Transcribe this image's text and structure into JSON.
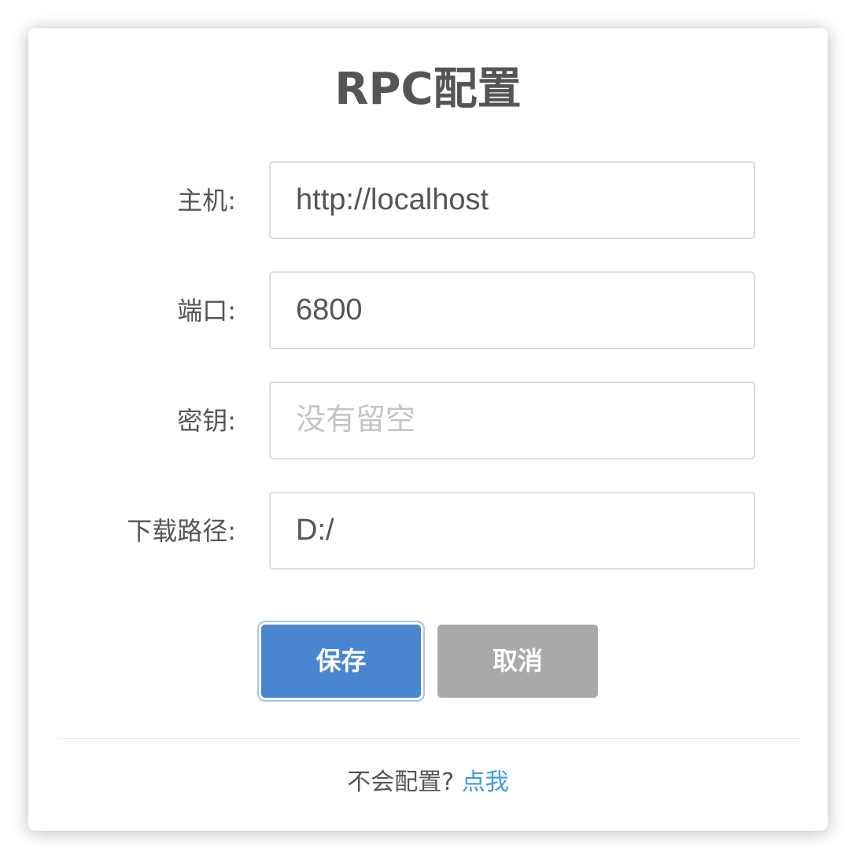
{
  "dialog": {
    "title": "RPC配置"
  },
  "form": {
    "host": {
      "label": "主机:",
      "value": "http://localhost",
      "placeholder": ""
    },
    "port": {
      "label": "端口:",
      "value": "6800",
      "placeholder": ""
    },
    "secret": {
      "label": "密钥:",
      "value": "",
      "placeholder": "没有留空"
    },
    "download_path": {
      "label": "下载路径:",
      "value": "D:/",
      "placeholder": ""
    }
  },
  "buttons": {
    "save_label": "保存",
    "cancel_label": "取消"
  },
  "footer": {
    "help_text": "不会配置?",
    "help_link": "点我"
  },
  "colors": {
    "primary": "#4a86d0",
    "cancel": "#a9a9a9",
    "link": "#3d9be0",
    "text": "#555555"
  }
}
